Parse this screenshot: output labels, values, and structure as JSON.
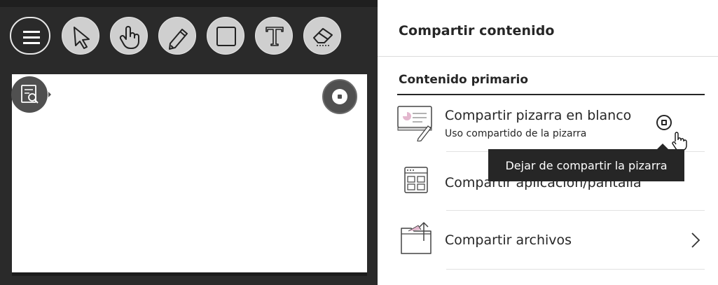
{
  "panel": {
    "title": "Compartir contenido",
    "section_title": "Contenido primario"
  },
  "items": [
    {
      "label": "Compartir pizarra en blanco",
      "sub": "Uso compartido de la pizarra",
      "icon": "whiteboard-icon"
    },
    {
      "label": "Compartir aplicación/pantalla",
      "icon": "application-window-icon"
    },
    {
      "label": "Compartir archivos",
      "icon": "folder-upload-icon"
    }
  ],
  "tooltip": "Dejar de compartir la pizarra",
  "toolbar": {
    "tools": [
      "menu-icon",
      "pointer-icon",
      "hand-icon",
      "pencil-icon",
      "rectangle-icon",
      "text-icon",
      "eraser-icon"
    ]
  },
  "colors": {
    "dark_panel": "#2a2a2a",
    "tool_bg": "#cfcfcf",
    "text": "#262626",
    "tooltip_bg": "#262626"
  }
}
